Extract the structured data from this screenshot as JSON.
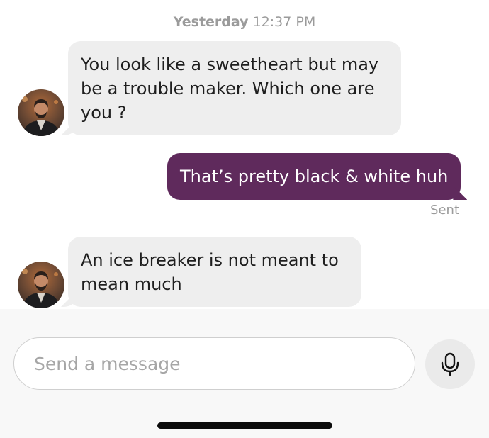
{
  "header": {
    "timestamp_day": "Yesterday",
    "timestamp_time": "12:37 PM"
  },
  "messages": [
    {
      "direction": "incoming",
      "text": "You look like a sweetheart but may be a trouble maker. Which one are you ?"
    },
    {
      "direction": "outgoing",
      "text": "That’s pretty black & white huh",
      "status": "Sent"
    },
    {
      "direction": "incoming",
      "text": "An ice breaker is not meant to mean much"
    }
  ],
  "composer": {
    "placeholder": "Send a message",
    "mic_icon": "microphone-icon"
  },
  "colors": {
    "outgoing_bubble": "#5f2a5c",
    "incoming_bubble": "#eeeeee",
    "meta_text": "#9b9b9b"
  }
}
